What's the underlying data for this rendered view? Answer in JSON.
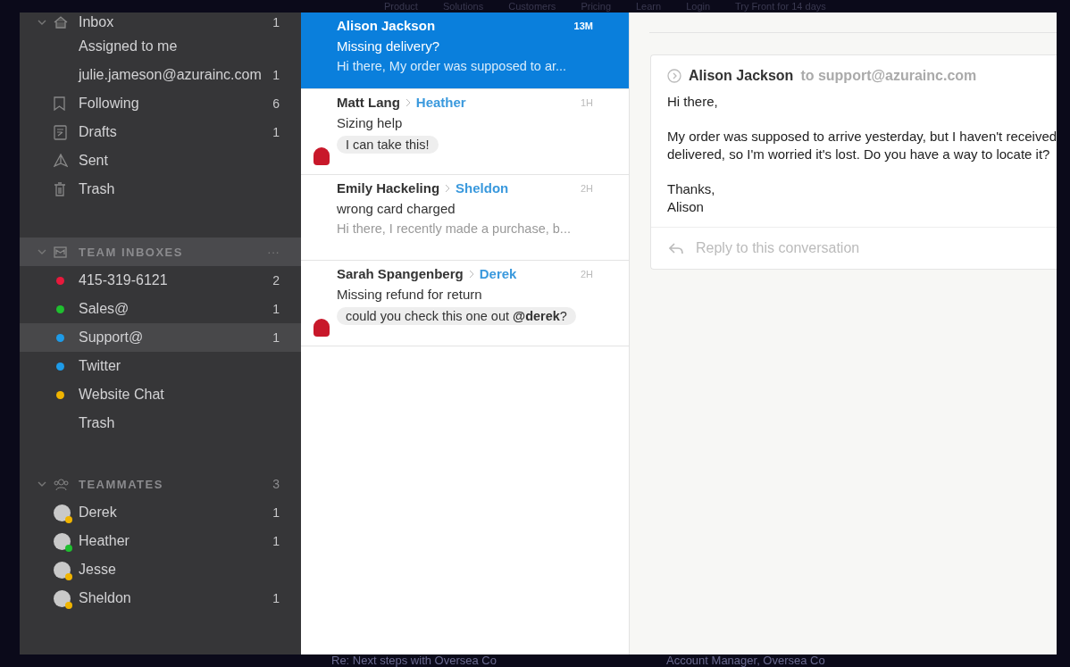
{
  "site_nav": {
    "items": [
      "Product",
      "Solutions",
      "Customers",
      "Pricing",
      "Learn",
      "Login",
      "Try Front for 14 days"
    ]
  },
  "sidebar": {
    "items": [
      {
        "label": "Inbox",
        "count": "1",
        "expanded": true
      },
      {
        "label": "Assigned to me"
      },
      {
        "label": "julie.jameson@azurainc.com",
        "count": "1"
      },
      {
        "label": "Following",
        "count": "6"
      },
      {
        "label": "Drafts",
        "count": "1"
      },
      {
        "label": "Sent"
      },
      {
        "label": "Trash"
      }
    ],
    "team_inboxes": {
      "title": "TEAM INBOXES",
      "more": "···",
      "expanded": true,
      "hovered": true,
      "items": [
        {
          "label": "415-319-6121",
          "count": "2",
          "color": "#e8193c",
          "selected": false
        },
        {
          "label": "Sales@",
          "count": "1",
          "color": "#1fbf2f",
          "selected": false
        },
        {
          "label": "Support@",
          "count": "1",
          "color": "#1e9be8",
          "selected": true
        },
        {
          "label": "Twitter",
          "color": "#1e9be8",
          "selected": false
        },
        {
          "label": "Website Chat",
          "color": "#f0b400",
          "selected": false
        },
        {
          "label": "Trash",
          "selected": false
        }
      ]
    },
    "teammates": {
      "title": "TEAMMATES",
      "count": "3",
      "expanded": true,
      "items": [
        {
          "name": "Derek",
          "count": "1",
          "color": "#f0b400"
        },
        {
          "name": "Heather",
          "count": "1",
          "color": "#1fbf2f"
        },
        {
          "name": "Jesse",
          "color": "#f0b400"
        },
        {
          "name": "Sheldon",
          "count": "1",
          "color": "#f0b400"
        }
      ]
    }
  },
  "conversations": [
    {
      "sender": "Alison Jackson",
      "time": "13M",
      "subject": "Missing delivery?",
      "preview": "Hi there, My order was supposed to ar...",
      "selected": true
    },
    {
      "sender": "Matt Lang",
      "assignee": "Heather",
      "time": "1H",
      "subject": "Sizing help",
      "comment": "I can take this!",
      "selected": false
    },
    {
      "sender": "Emily Hackeling",
      "assignee": "Sheldon",
      "time": "2H",
      "subject": "wrong card charged",
      "preview": "Hi there, I recently made a purchase, b...",
      "selected": false
    },
    {
      "sender": "Sarah Spangenberg",
      "assignee": "Derek",
      "time": "2H",
      "subject": "Missing refund for return",
      "comment": "could you check this one out **@derek**?",
      "selected": false
    }
  ],
  "message": {
    "from": "Alison Jackson",
    "to": "to support@azurainc.com",
    "body": [
      "Hi there,",
      "My order was supposed to arrive yesterday, but I haven't received",
      "delivered, so I'm worried it's lost. Do you have a way to locate it?",
      "Thanks,",
      "Alison"
    ],
    "reply_placeholder": "Reply to this conversation"
  },
  "background_texts": [
    "Re: Next steps with Oversea Co",
    "Account Manager, Oversea Co"
  ]
}
